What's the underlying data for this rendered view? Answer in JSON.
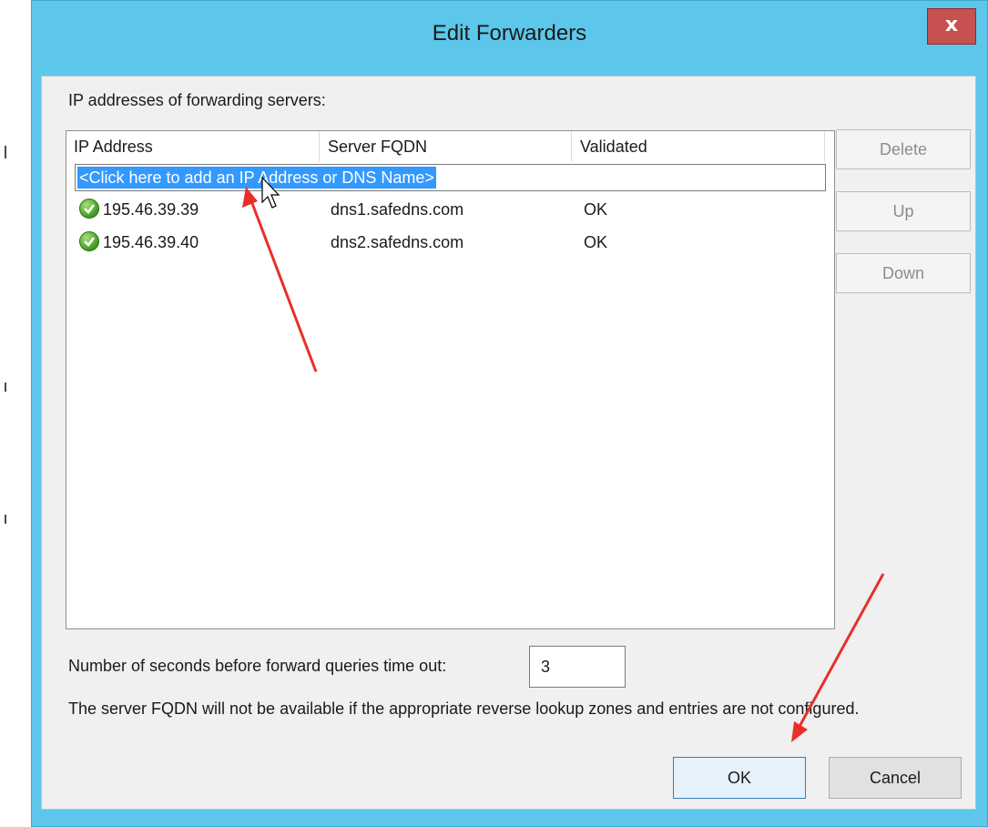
{
  "window": {
    "title": "Edit Forwarders",
    "close_label": "x"
  },
  "list": {
    "caption": "IP addresses of forwarding servers:",
    "columns": [
      "IP Address",
      "Server FQDN",
      "Validated"
    ],
    "add_prompt": "<Click here to add an IP Address or DNS Name>",
    "rows": [
      {
        "ip": "195.46.39.39",
        "fqdn": "dns1.safedns.com",
        "validated": "OK",
        "status_icon": "check-circle-icon"
      },
      {
        "ip": "195.46.39.40",
        "fqdn": "dns2.safedns.com",
        "validated": "OK",
        "status_icon": "check-circle-icon"
      }
    ]
  },
  "side_buttons": {
    "delete": "Delete",
    "up": "Up",
    "down": "Down"
  },
  "timeout": {
    "label": "Number of seconds before forward queries time out:",
    "value": "3"
  },
  "note": "The server FQDN will not be available if the appropriate reverse lookup zones and entries are not configured.",
  "buttons": {
    "ok": "OK",
    "cancel": "Cancel"
  },
  "colors": {
    "titlebar": "#5cc7ea",
    "close": "#c75050",
    "selection": "#3399ff",
    "annotation_arrow": "#e8302a"
  }
}
